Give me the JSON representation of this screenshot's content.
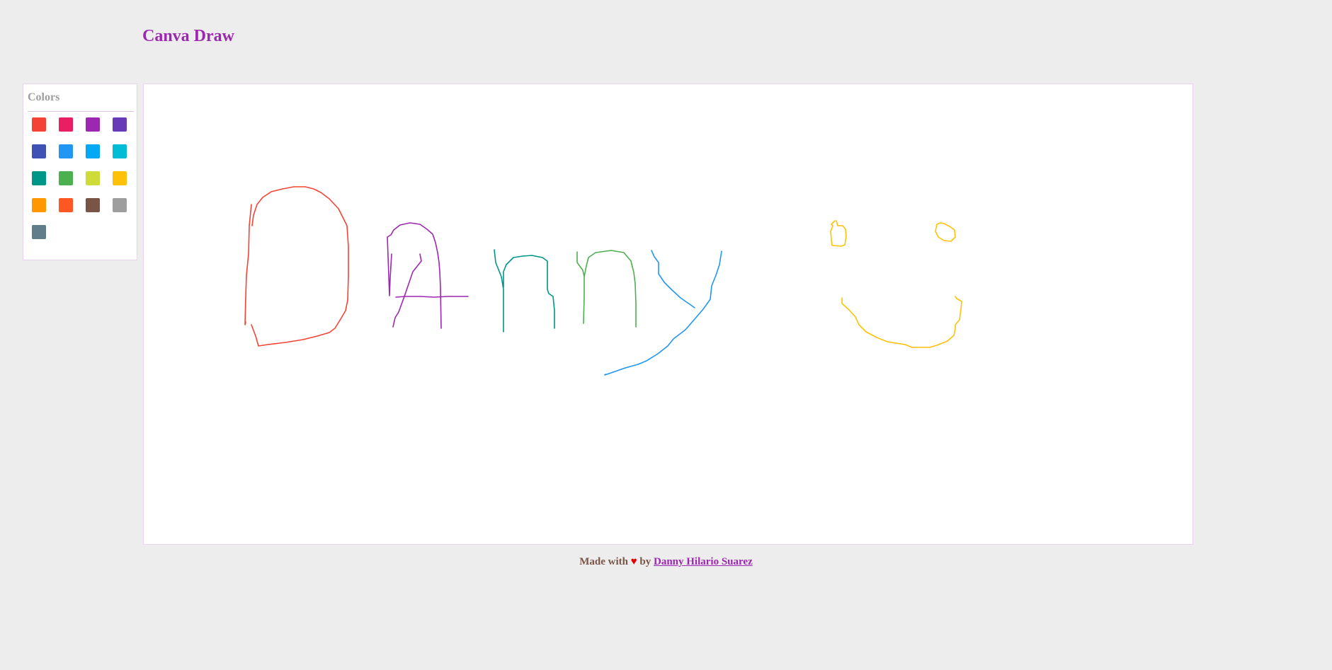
{
  "app": {
    "title": "Canva Draw"
  },
  "palette": {
    "title": "Colors",
    "colors": [
      "#f44336",
      "#e91e63",
      "#9c27b0",
      "#673ab7",
      "#3f51b5",
      "#2196f3",
      "#03a9f4",
      "#00bcd4",
      "#009688",
      "#4caf50",
      "#cddc39",
      "#ffc107",
      "#ff9800",
      "#ff5722",
      "#795548",
      "#9e9e9e",
      "#607d8b"
    ]
  },
  "drawing": {
    "strokes": [
      {
        "name": "letter-d-stroke",
        "color": "#f44336"
      },
      {
        "name": "letter-a-stroke",
        "color": "#9c27b0"
      },
      {
        "name": "letter-a-crossbar-stroke",
        "color": "#9c27b0"
      },
      {
        "name": "letter-n-stroke",
        "color": "#009688"
      },
      {
        "name": "letter-n2-stroke",
        "color": "#4caf50"
      },
      {
        "name": "letter-y-left-stroke",
        "color": "#2196f3"
      },
      {
        "name": "letter-y-right-stroke",
        "color": "#2196f3"
      },
      {
        "name": "smiley-left-eye-stroke",
        "color": "#ffc107"
      },
      {
        "name": "smiley-right-eye-stroke",
        "color": "#ffc107"
      },
      {
        "name": "smiley-mouth-stroke",
        "color": "#ffc107"
      }
    ]
  },
  "footer": {
    "made_with": "Made with",
    "heart": "♥",
    "by": "by",
    "author": "Danny Hilario Suarez"
  }
}
